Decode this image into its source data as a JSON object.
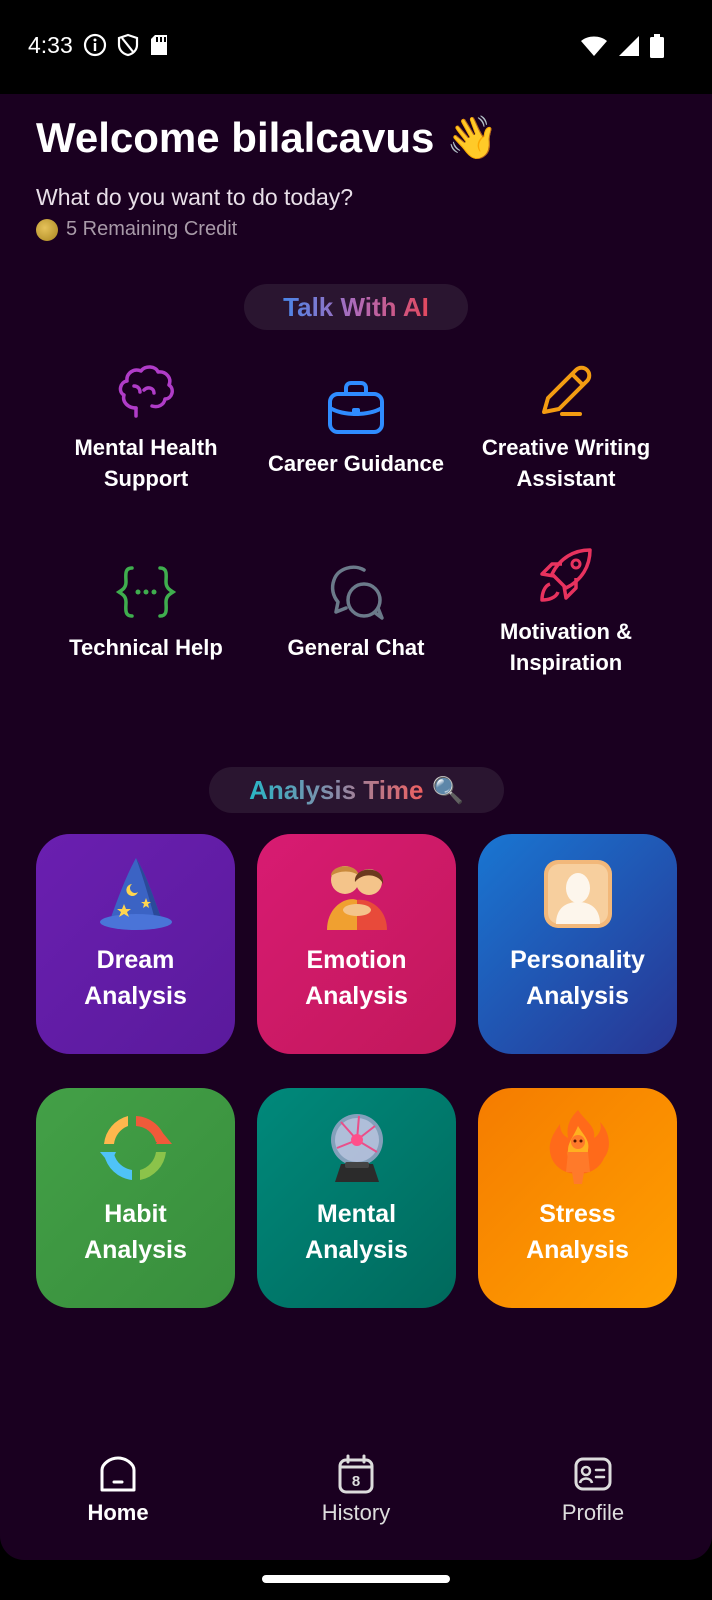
{
  "status_bar": {
    "time": "4:33",
    "left_icons": [
      "info-icon",
      "shield-icon",
      "sd-card-icon"
    ],
    "right_icons": [
      "wifi-icon",
      "signal-icon",
      "battery-icon"
    ]
  },
  "header": {
    "welcome": "Welcome bilalcavus 👋",
    "subtitle": "What do you want to do today?",
    "credit": "5 Remaining Credit"
  },
  "talk_section": {
    "title": "Talk With AI",
    "items": [
      {
        "label_line1": "Mental Health",
        "label_line2": "Support",
        "icon": "brain-icon",
        "color": "#b03cc8"
      },
      {
        "label_line1": "Career Guidance",
        "label_line2": "",
        "icon": "briefcase-icon",
        "color": "#2f8cff"
      },
      {
        "label_line1": "Creative Writing",
        "label_line2": "Assistant",
        "icon": "pencil-icon",
        "color": "#f39c12"
      },
      {
        "label_line1": "Technical Help",
        "label_line2": "",
        "icon": "code-braces-icon",
        "color": "#3fae4e"
      },
      {
        "label_line1": "General Chat",
        "label_line2": "",
        "icon": "chat-bubbles-icon",
        "color": "#6b7a8a"
      },
      {
        "label_line1": "Motivation &",
        "label_line2": "Inspiration",
        "icon": "rocket-icon",
        "color": "#e8325e"
      }
    ]
  },
  "analysis_section": {
    "title_part1": "Analysis Time",
    "title_emoji": "🔍",
    "cards": [
      {
        "line1": "Dream",
        "line2": "Analysis",
        "icon": "wizard-hat-icon"
      },
      {
        "line1": "Emotion",
        "line2": "Analysis",
        "icon": "hugging-people-icon"
      },
      {
        "line1": "Personality",
        "line2": "Analysis",
        "icon": "person-silhouette-icon"
      },
      {
        "line1": "Habit",
        "line2": "Analysis",
        "icon": "cycle-arrows-icon"
      },
      {
        "line1": "Mental",
        "line2": "Analysis",
        "icon": "plasma-ball-icon"
      },
      {
        "line1": "Stress",
        "line2": "Analysis",
        "icon": "fire-person-icon"
      }
    ]
  },
  "bottom_nav": {
    "home": "Home",
    "history": "History",
    "history_badge": "8",
    "profile": "Profile"
  }
}
